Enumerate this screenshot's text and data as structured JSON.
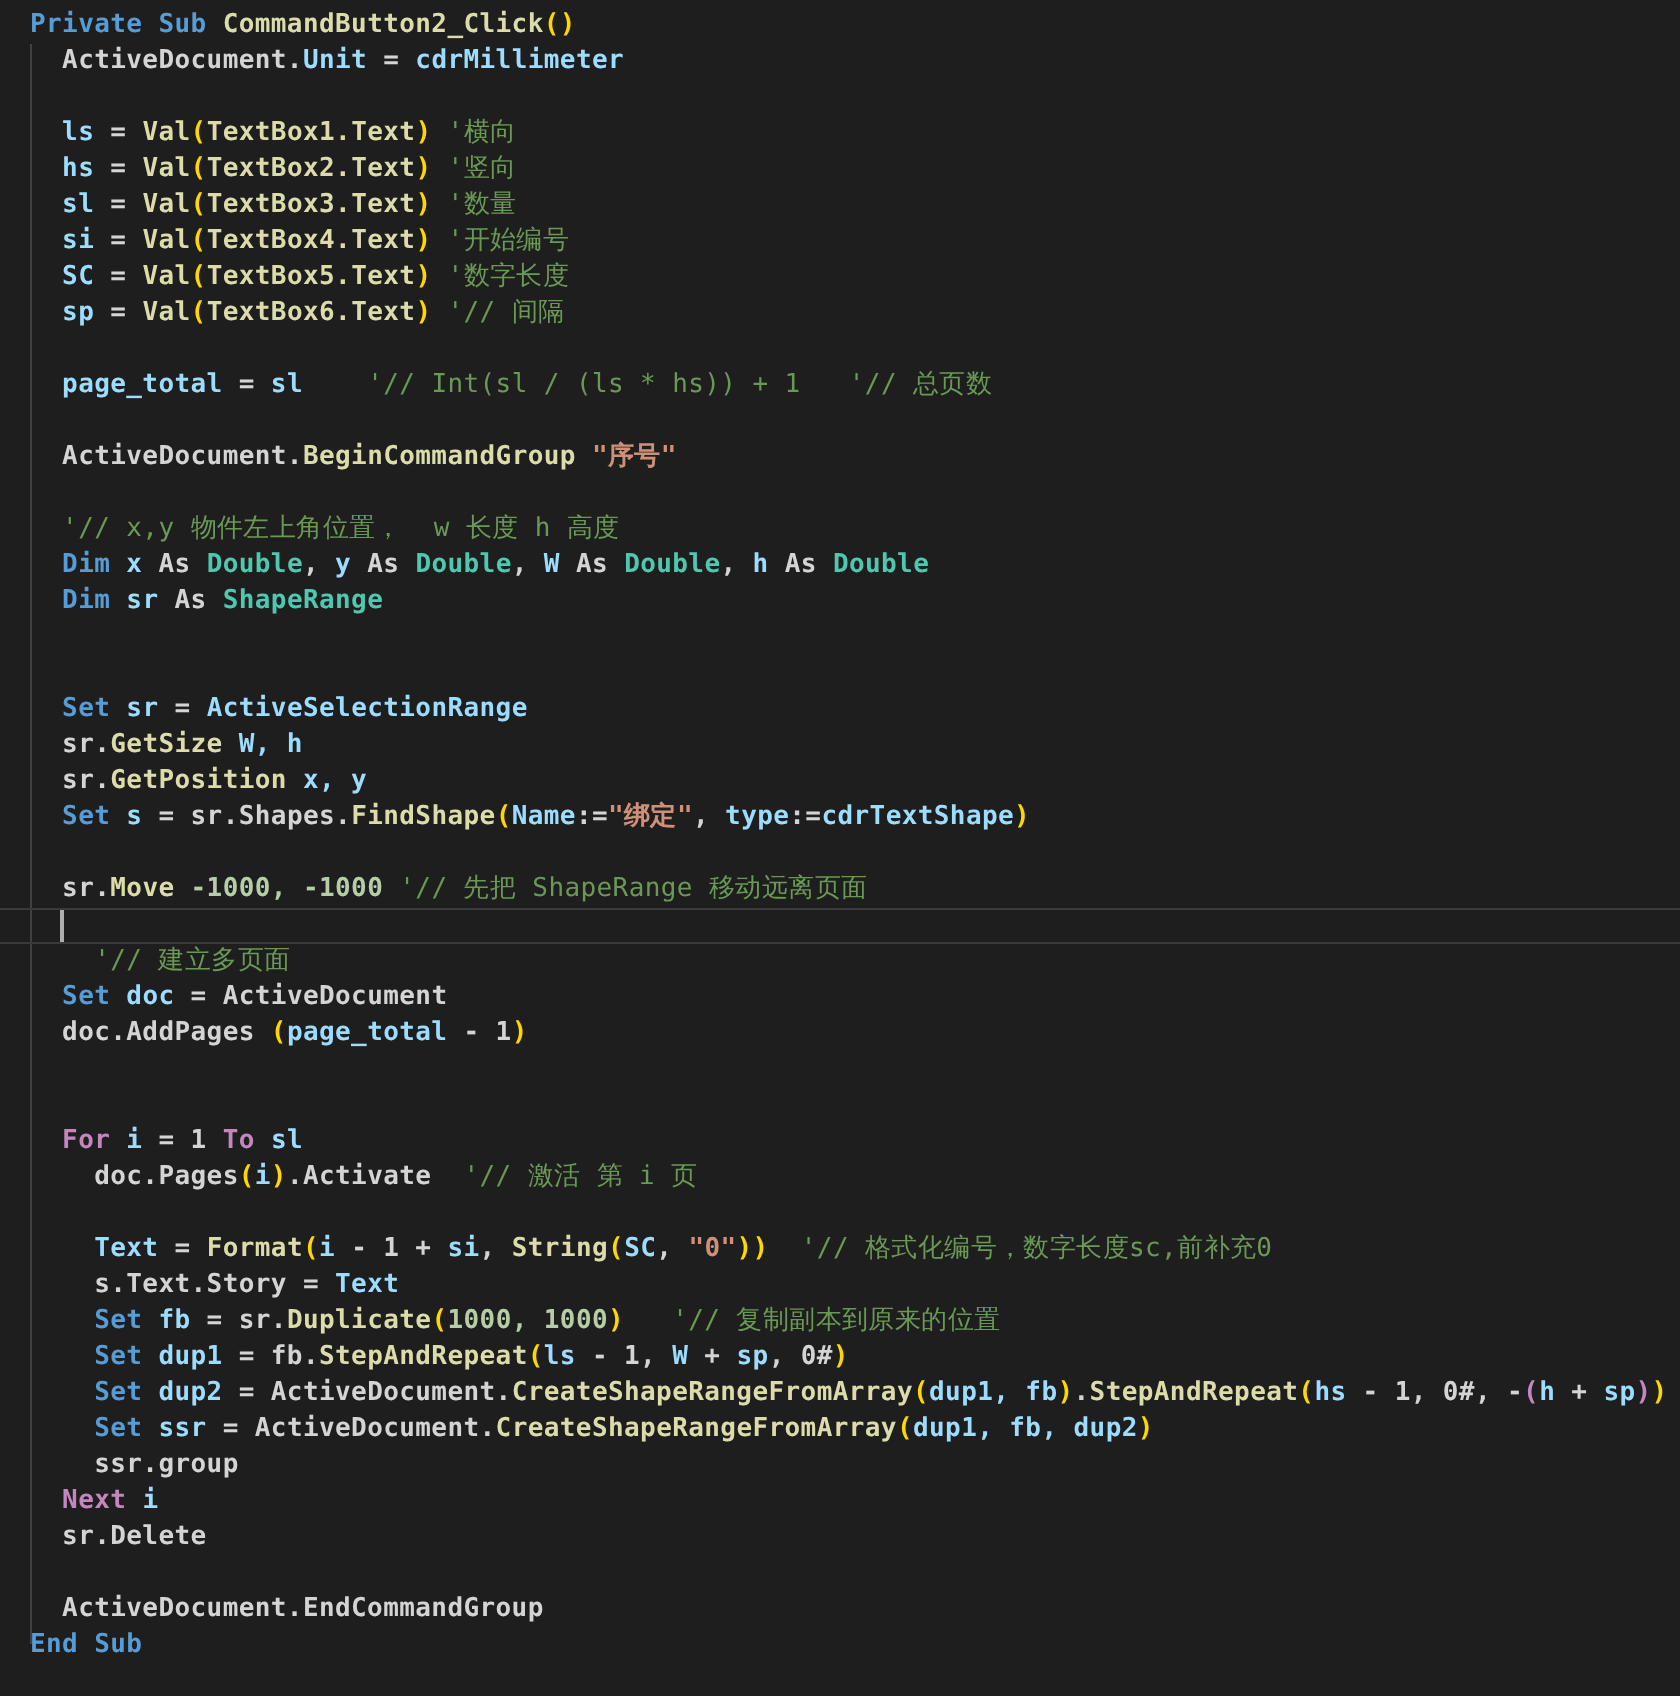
{
  "editor": {
    "lines": [
      {
        "kind": "code",
        "tokens": [
          {
            "kind": "keyword",
            "text": "Private Sub "
          },
          {
            "kind": "call",
            "text": "CommandButton2_Click"
          },
          {
            "kind": "bracket",
            "text": "()"
          }
        ]
      },
      {
        "kind": "code",
        "tokens": [
          {
            "kind": "plain",
            "text": "  ActiveDocument."
          },
          {
            "kind": "name",
            "text": "Unit"
          },
          {
            "kind": "plain",
            "text": " = "
          },
          {
            "kind": "name",
            "text": "cdrMillimeter"
          }
        ]
      },
      {
        "kind": "blank"
      },
      {
        "kind": "code",
        "tokens": [
          {
            "kind": "name",
            "text": "  ls"
          },
          {
            "kind": "plain",
            "text": " = "
          },
          {
            "kind": "call",
            "text": "Val"
          },
          {
            "kind": "bracket",
            "text": "("
          },
          {
            "kind": "call",
            "text": "TextBox1.Text"
          },
          {
            "kind": "bracket",
            "text": ")"
          },
          {
            "kind": "comment",
            "text": " '横向"
          }
        ]
      },
      {
        "kind": "code",
        "tokens": [
          {
            "kind": "name",
            "text": "  hs"
          },
          {
            "kind": "plain",
            "text": " = "
          },
          {
            "kind": "call",
            "text": "Val"
          },
          {
            "kind": "bracket",
            "text": "("
          },
          {
            "kind": "call",
            "text": "TextBox2.Text"
          },
          {
            "kind": "bracket",
            "text": ")"
          },
          {
            "kind": "comment",
            "text": " '竖向"
          }
        ]
      },
      {
        "kind": "code",
        "tokens": [
          {
            "kind": "name",
            "text": "  sl"
          },
          {
            "kind": "plain",
            "text": " = "
          },
          {
            "kind": "call",
            "text": "Val"
          },
          {
            "kind": "bracket",
            "text": "("
          },
          {
            "kind": "call",
            "text": "TextBox3.Text"
          },
          {
            "kind": "bracket",
            "text": ")"
          },
          {
            "kind": "comment",
            "text": " '数量"
          }
        ]
      },
      {
        "kind": "code",
        "tokens": [
          {
            "kind": "name",
            "text": "  si"
          },
          {
            "kind": "plain",
            "text": " = "
          },
          {
            "kind": "call",
            "text": "Val"
          },
          {
            "kind": "bracket",
            "text": "("
          },
          {
            "kind": "call",
            "text": "TextBox4.Text"
          },
          {
            "kind": "bracket",
            "text": ")"
          },
          {
            "kind": "comment",
            "text": " '开始编号"
          }
        ]
      },
      {
        "kind": "code",
        "tokens": [
          {
            "kind": "name",
            "text": "  SC"
          },
          {
            "kind": "plain",
            "text": " = "
          },
          {
            "kind": "call",
            "text": "Val"
          },
          {
            "kind": "bracket",
            "text": "("
          },
          {
            "kind": "call",
            "text": "TextBox5.Text"
          },
          {
            "kind": "bracket",
            "text": ")"
          },
          {
            "kind": "comment",
            "text": " '数字长度"
          }
        ]
      },
      {
        "kind": "code",
        "tokens": [
          {
            "kind": "name",
            "text": "  sp"
          },
          {
            "kind": "plain",
            "text": " = "
          },
          {
            "kind": "call",
            "text": "Val"
          },
          {
            "kind": "bracket",
            "text": "("
          },
          {
            "kind": "call",
            "text": "TextBox6.Text"
          },
          {
            "kind": "bracket",
            "text": ")"
          },
          {
            "kind": "comment",
            "text": " '// 间隔"
          }
        ]
      },
      {
        "kind": "blank"
      },
      {
        "kind": "code",
        "tokens": [
          {
            "kind": "name",
            "text": "  page_total"
          },
          {
            "kind": "plain",
            "text": " = "
          },
          {
            "kind": "name",
            "text": "sl"
          },
          {
            "kind": "comment",
            "text": "    '// Int(sl / (ls * hs)) + 1   '// 总页数"
          }
        ]
      },
      {
        "kind": "blank"
      },
      {
        "kind": "code",
        "tokens": [
          {
            "kind": "plain",
            "text": "  ActiveDocument."
          },
          {
            "kind": "call",
            "text": "BeginCommandGroup"
          },
          {
            "kind": "string",
            "text": " \"序号\""
          }
        ]
      },
      {
        "kind": "blank"
      },
      {
        "kind": "code",
        "tokens": [
          {
            "kind": "comment",
            "text": "  '// x,y 物件左上角位置，  w 长度 h 高度"
          }
        ]
      },
      {
        "kind": "code",
        "tokens": [
          {
            "kind": "keyword",
            "text": "  Dim "
          },
          {
            "kind": "name",
            "text": "x"
          },
          {
            "kind": "plain",
            "text": " As "
          },
          {
            "kind": "type",
            "text": "Double"
          },
          {
            "kind": "plain",
            "text": ", "
          },
          {
            "kind": "name",
            "text": "y"
          },
          {
            "kind": "plain",
            "text": " As "
          },
          {
            "kind": "type",
            "text": "Double"
          },
          {
            "kind": "plain",
            "text": ", "
          },
          {
            "kind": "name",
            "text": "W"
          },
          {
            "kind": "plain",
            "text": " As "
          },
          {
            "kind": "type",
            "text": "Double"
          },
          {
            "kind": "plain",
            "text": ", "
          },
          {
            "kind": "name",
            "text": "h"
          },
          {
            "kind": "plain",
            "text": " As "
          },
          {
            "kind": "type",
            "text": "Double"
          }
        ]
      },
      {
        "kind": "code",
        "tokens": [
          {
            "kind": "keyword",
            "text": "  Dim "
          },
          {
            "kind": "name",
            "text": "sr"
          },
          {
            "kind": "plain",
            "text": " As "
          },
          {
            "kind": "type",
            "text": "ShapeRange"
          }
        ]
      },
      {
        "kind": "blank"
      },
      {
        "kind": "blank"
      },
      {
        "kind": "code",
        "tokens": [
          {
            "kind": "keyword",
            "text": "  Set "
          },
          {
            "kind": "name",
            "text": "sr"
          },
          {
            "kind": "plain",
            "text": " = "
          },
          {
            "kind": "name",
            "text": "ActiveSelectionRange"
          }
        ]
      },
      {
        "kind": "code",
        "tokens": [
          {
            "kind": "plain",
            "text": "  sr."
          },
          {
            "kind": "call",
            "text": "GetSize"
          },
          {
            "kind": "name",
            "text": " W, h"
          }
        ]
      },
      {
        "kind": "code",
        "tokens": [
          {
            "kind": "plain",
            "text": "  sr."
          },
          {
            "kind": "call",
            "text": "GetPosition"
          },
          {
            "kind": "name",
            "text": " x, y"
          }
        ]
      },
      {
        "kind": "code",
        "tokens": [
          {
            "kind": "keyword",
            "text": "  Set "
          },
          {
            "kind": "name",
            "text": "s"
          },
          {
            "kind": "plain",
            "text": " = sr.Shapes."
          },
          {
            "kind": "call",
            "text": "FindShape"
          },
          {
            "kind": "bracket",
            "text": "("
          },
          {
            "kind": "name",
            "text": "Name"
          },
          {
            "kind": "plain",
            "text": ":="
          },
          {
            "kind": "string",
            "text": "\"绑定\""
          },
          {
            "kind": "plain",
            "text": ", "
          },
          {
            "kind": "name",
            "text": "type"
          },
          {
            "kind": "plain",
            "text": ":="
          },
          {
            "kind": "name",
            "text": "cdrTextShape"
          },
          {
            "kind": "bracket",
            "text": ")"
          }
        ]
      },
      {
        "kind": "blank"
      },
      {
        "kind": "code",
        "tokens": [
          {
            "kind": "plain",
            "text": "  sr."
          },
          {
            "kind": "call",
            "text": "Move"
          },
          {
            "kind": "number",
            "text": " -1000, -1000"
          },
          {
            "kind": "comment",
            "text": " '// 先把 ShapeRange 移动远离页面"
          }
        ]
      },
      {
        "kind": "blank",
        "current": true
      },
      {
        "kind": "code",
        "tokens": [
          {
            "kind": "comment",
            "text": "    '// 建立多页面"
          }
        ]
      },
      {
        "kind": "code",
        "tokens": [
          {
            "kind": "keyword",
            "text": "  Set "
          },
          {
            "kind": "name",
            "text": "doc"
          },
          {
            "kind": "plain",
            "text": " = ActiveDocument"
          }
        ]
      },
      {
        "kind": "code",
        "tokens": [
          {
            "kind": "plain",
            "text": "  doc.AddPages "
          },
          {
            "kind": "bracket",
            "text": "("
          },
          {
            "kind": "name",
            "text": "page_total"
          },
          {
            "kind": "plain",
            "text": " - 1"
          },
          {
            "kind": "bracket",
            "text": ")"
          }
        ]
      },
      {
        "kind": "blank"
      },
      {
        "kind": "blank"
      },
      {
        "kind": "code",
        "tokens": [
          {
            "kind": "flow",
            "text": "  For "
          },
          {
            "kind": "name",
            "text": "i"
          },
          {
            "kind": "plain",
            "text": " = 1 "
          },
          {
            "kind": "flow",
            "text": "To "
          },
          {
            "kind": "name",
            "text": "sl"
          }
        ]
      },
      {
        "kind": "code",
        "tokens": [
          {
            "kind": "plain",
            "text": "    doc.Pages"
          },
          {
            "kind": "bracket",
            "text": "("
          },
          {
            "kind": "name",
            "text": "i"
          },
          {
            "kind": "bracket",
            "text": ")"
          },
          {
            "kind": "plain",
            "text": ".Activate"
          },
          {
            "kind": "comment",
            "text": "  '// 激活 第 i 页"
          }
        ]
      },
      {
        "kind": "blank"
      },
      {
        "kind": "code",
        "tokens": [
          {
            "kind": "name",
            "text": "    Text"
          },
          {
            "kind": "plain",
            "text": " = "
          },
          {
            "kind": "call",
            "text": "Format"
          },
          {
            "kind": "bracket",
            "text": "("
          },
          {
            "kind": "name",
            "text": "i"
          },
          {
            "kind": "plain",
            "text": " - 1 + "
          },
          {
            "kind": "name",
            "text": "si"
          },
          {
            "kind": "plain",
            "text": ", "
          },
          {
            "kind": "call",
            "text": "String"
          },
          {
            "kind": "bracket",
            "text": "("
          },
          {
            "kind": "name",
            "text": "SC"
          },
          {
            "kind": "plain",
            "text": ", "
          },
          {
            "kind": "string",
            "text": "\"0\""
          },
          {
            "kind": "bracket",
            "text": "))"
          },
          {
            "kind": "comment",
            "text": "  '// 格式化编号，数字长度sc,前补充0"
          }
        ]
      },
      {
        "kind": "code",
        "tokens": [
          {
            "kind": "plain",
            "text": "    s.Text.Story = "
          },
          {
            "kind": "name",
            "text": "Text"
          }
        ]
      },
      {
        "kind": "code",
        "tokens": [
          {
            "kind": "keyword",
            "text": "    Set "
          },
          {
            "kind": "name",
            "text": "fb"
          },
          {
            "kind": "plain",
            "text": " = sr."
          },
          {
            "kind": "call",
            "text": "Duplicate"
          },
          {
            "kind": "bracket",
            "text": "("
          },
          {
            "kind": "number",
            "text": "1000, 1000"
          },
          {
            "kind": "bracket",
            "text": ")"
          },
          {
            "kind": "comment",
            "text": "   '// 复制副本到原来的位置"
          }
        ]
      },
      {
        "kind": "code",
        "tokens": [
          {
            "kind": "keyword",
            "text": "    Set "
          },
          {
            "kind": "name",
            "text": "dup1"
          },
          {
            "kind": "plain",
            "text": " = fb."
          },
          {
            "kind": "call",
            "text": "StepAndRepeat"
          },
          {
            "kind": "bracket",
            "text": "("
          },
          {
            "kind": "name",
            "text": "ls"
          },
          {
            "kind": "plain",
            "text": " - 1, "
          },
          {
            "kind": "name",
            "text": "W"
          },
          {
            "kind": "plain",
            "text": " + "
          },
          {
            "kind": "name",
            "text": "sp"
          },
          {
            "kind": "plain",
            "text": ", 0#"
          },
          {
            "kind": "bracket",
            "text": ")"
          }
        ]
      },
      {
        "kind": "code",
        "tokens": [
          {
            "kind": "keyword",
            "text": "    Set "
          },
          {
            "kind": "name",
            "text": "dup2"
          },
          {
            "kind": "plain",
            "text": " = ActiveDocument."
          },
          {
            "kind": "call",
            "text": "CreateShapeRangeFromArray"
          },
          {
            "kind": "bracket",
            "text": "("
          },
          {
            "kind": "name",
            "text": "dup1, fb"
          },
          {
            "kind": "bracket",
            "text": ")"
          },
          {
            "kind": "plain",
            "text": "."
          },
          {
            "kind": "call",
            "text": "StepAndRepeat"
          },
          {
            "kind": "bracket",
            "text": "("
          },
          {
            "kind": "name",
            "text": "hs"
          },
          {
            "kind": "plain",
            "text": " - 1, 0#, -"
          },
          {
            "kind": "flow",
            "text": "("
          },
          {
            "kind": "name",
            "text": "h"
          },
          {
            "kind": "plain",
            "text": " + "
          },
          {
            "kind": "name",
            "text": "sp"
          },
          {
            "kind": "flow",
            "text": ")"
          },
          {
            "kind": "bracket",
            "text": ")"
          }
        ]
      },
      {
        "kind": "code",
        "tokens": [
          {
            "kind": "keyword",
            "text": "    Set "
          },
          {
            "kind": "name",
            "text": "ssr"
          },
          {
            "kind": "plain",
            "text": " = ActiveDocument."
          },
          {
            "kind": "call",
            "text": "CreateShapeRangeFromArray"
          },
          {
            "kind": "bracket",
            "text": "("
          },
          {
            "kind": "name",
            "text": "dup1, fb, dup2"
          },
          {
            "kind": "bracket",
            "text": ")"
          }
        ]
      },
      {
        "kind": "code",
        "tokens": [
          {
            "kind": "plain",
            "text": "    ssr.group"
          }
        ]
      },
      {
        "kind": "code",
        "tokens": [
          {
            "kind": "flow",
            "text": "  Next "
          },
          {
            "kind": "name",
            "text": "i"
          }
        ]
      },
      {
        "kind": "code",
        "tokens": [
          {
            "kind": "plain",
            "text": "  sr.Delete"
          }
        ]
      },
      {
        "kind": "blank"
      },
      {
        "kind": "code",
        "tokens": [
          {
            "kind": "plain",
            "text": "  ActiveDocument.EndCommandGroup"
          }
        ]
      },
      {
        "kind": "code",
        "tokens": [
          {
            "kind": "keyword",
            "text": "End Sub"
          }
        ]
      }
    ]
  }
}
